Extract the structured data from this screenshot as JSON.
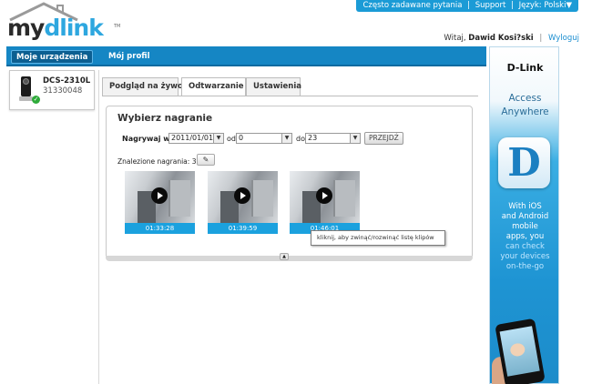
{
  "toplinks": {
    "faq": "Często zadawane pytania",
    "support": "Support",
    "lang_label": "Język: Polski",
    "lang_arrow": "▼"
  },
  "logo": {
    "my": "my",
    "dlink": "dlink",
    "tm": "TM"
  },
  "welcome": {
    "greeting": "Witaj,",
    "user": "Dawid Kosi?ski",
    "logout": "Wyloguj"
  },
  "nav": {
    "devices": "Moje urządzenia",
    "profile": "Mój profil"
  },
  "device": {
    "name": "DCS-2310L",
    "id": "31330048"
  },
  "tabs": {
    "live": "Podgląd na żywo",
    "playback": "Odtwarzanie",
    "settings": "Ustawienia"
  },
  "panel": {
    "title": "Wybierz nagranie",
    "record_label": "Nagrywaj w",
    "date_value": "2011/01/01",
    "from_label": "od",
    "from_value": "0",
    "to_label": "do",
    "to_value": "23",
    "go_button": "PRZEJDŹ",
    "found_label": "Znalezione nagrania:",
    "found_count": "3 ."
  },
  "clips": [
    {
      "time": "01:33:28"
    },
    {
      "time": "01:39:59"
    },
    {
      "time": "01:46:01"
    }
  ],
  "tooltip": "kliknij, aby zwinąć/rozwinąć listę klipów",
  "ad": {
    "brand": "D-Link",
    "tagline1": "Access",
    "tagline2": "Anywhere",
    "logo_letter": "D",
    "line1": "With iOS",
    "line2": "and Android",
    "line3": "mobile",
    "line4": "apps, you",
    "line5": "can check",
    "line6": "your devices",
    "line7": "on-the-go"
  },
  "colors": {
    "accent": "#1b9bd6",
    "nav": "#1586c4",
    "clip_bar": "#1ba1de"
  }
}
